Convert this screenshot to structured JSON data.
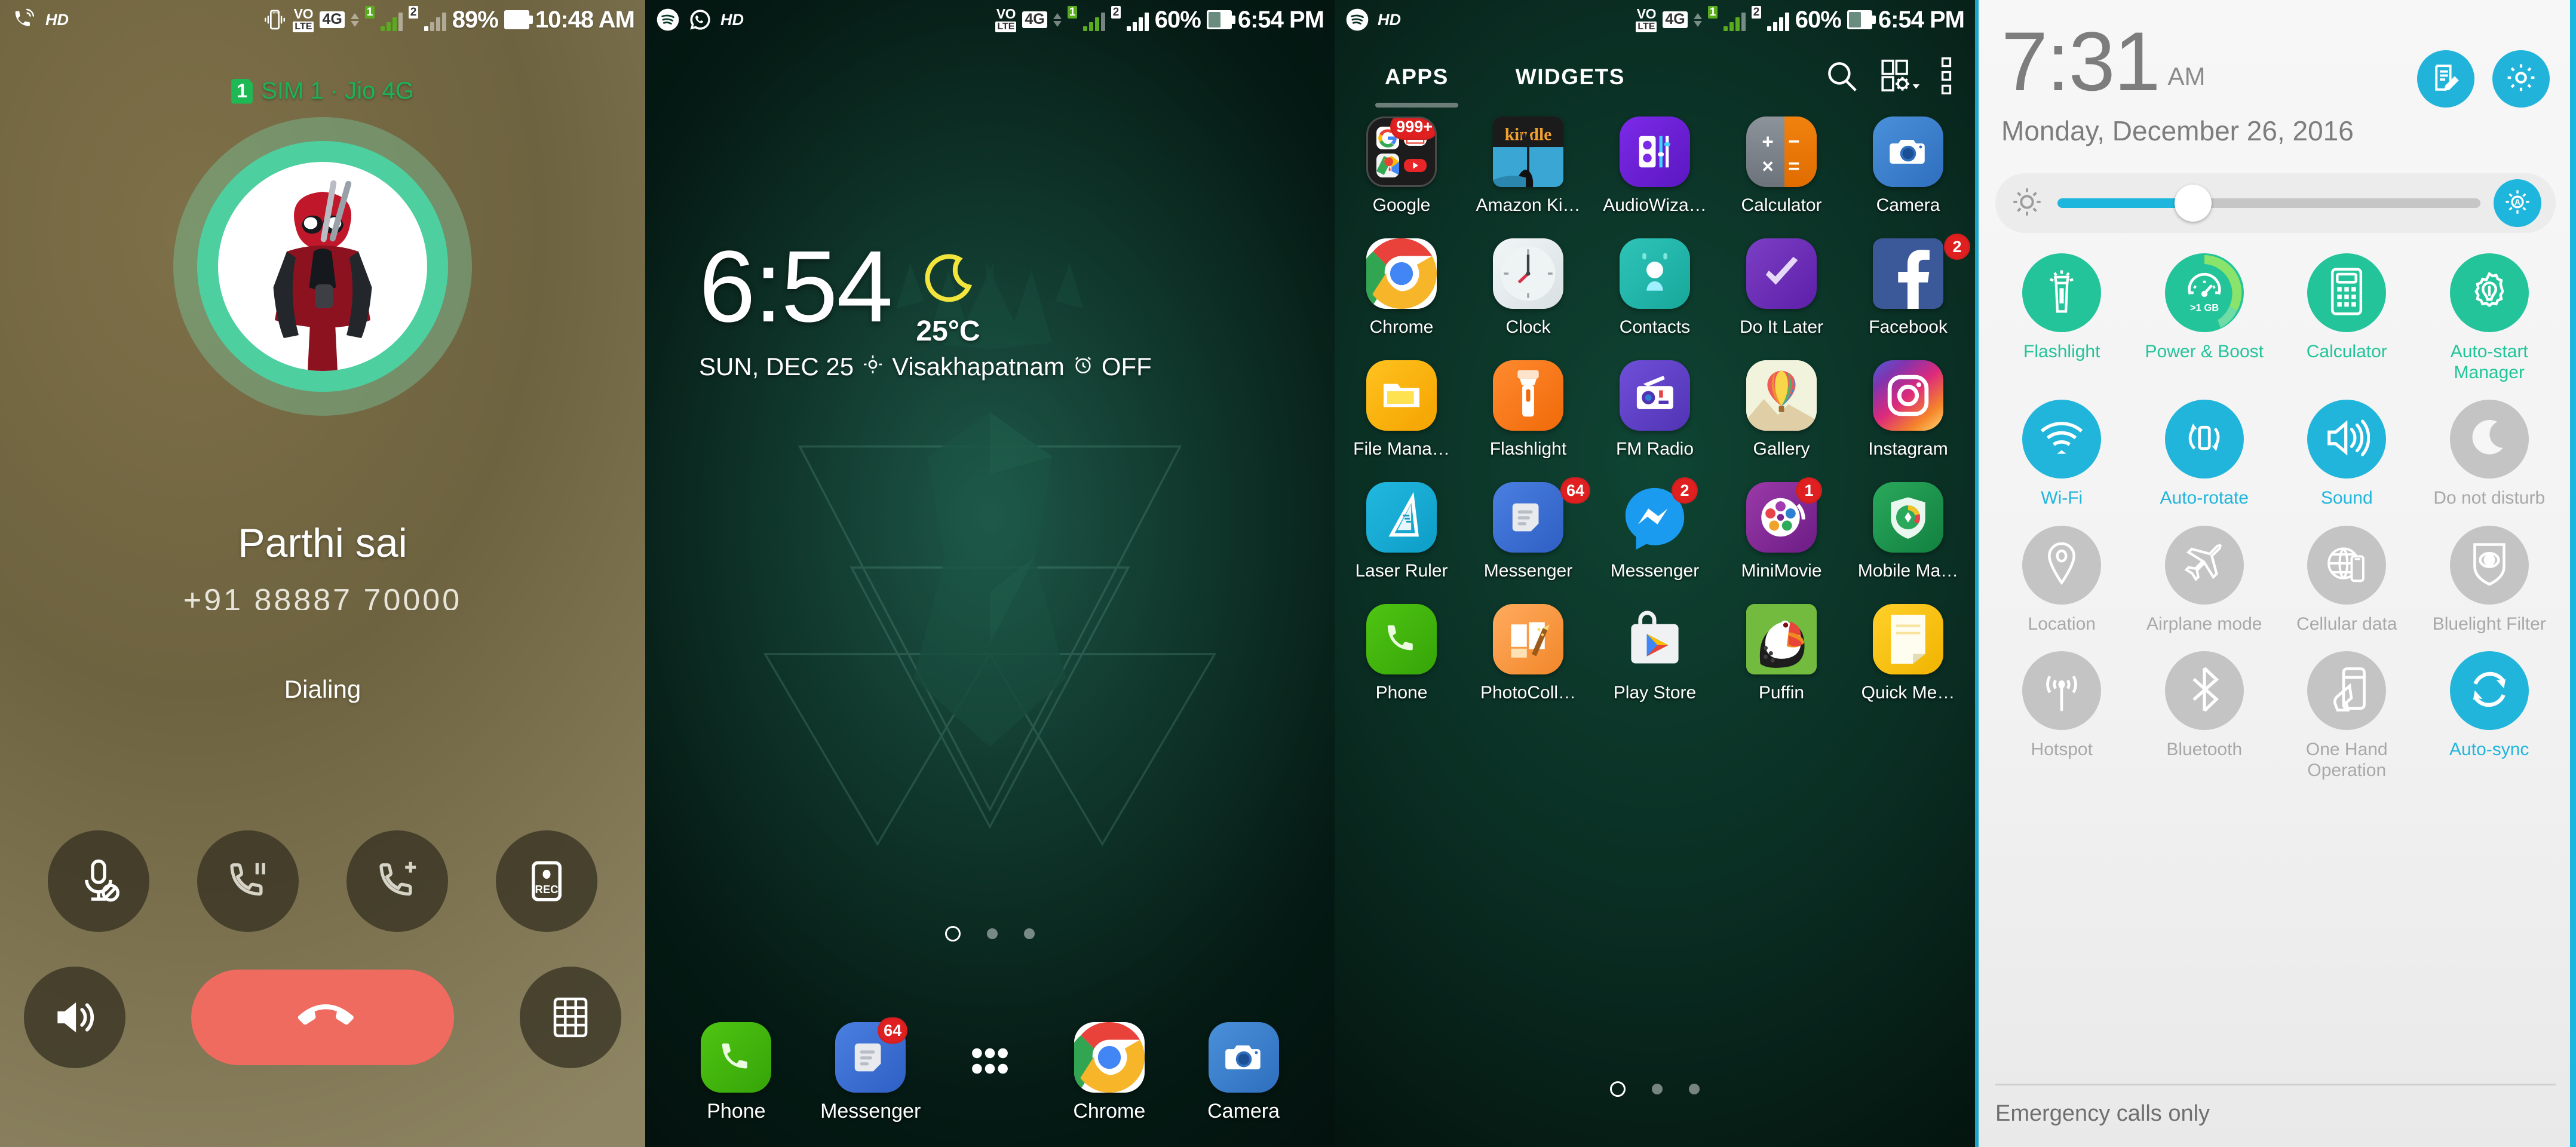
{
  "panel_call": {
    "statusbar": {
      "hd_label": "HD",
      "icons": [
        "call-hd-icon",
        "vibrate-icon",
        "volte-icon",
        "4g-icon",
        "data-arrows-icon",
        "sim1-signal-icon",
        "sim2-signal-icon"
      ],
      "volte_top": "VO",
      "volte_bottom": "LTE",
      "network_type": "4G",
      "sim1_label": "1",
      "sim2_label": "2",
      "battery_percent": "89%",
      "clock": "10:48 AM"
    },
    "sim_chip": "1",
    "sim_line": "SIM 1 · Jio 4G",
    "contact_name": "Parthi sai",
    "contact_number": "+91 88887 70000",
    "call_status": "Dialing",
    "controls": [
      {
        "name": "mute-button",
        "label": "Mute"
      },
      {
        "name": "hold-button",
        "label": "Hold"
      },
      {
        "name": "add-call-button",
        "label": "Add call"
      },
      {
        "name": "record-button",
        "label": "REC"
      }
    ],
    "controls_row2": [
      {
        "name": "speaker-button",
        "label": "Speaker"
      },
      {
        "name": "end-call-button",
        "label": "End call"
      },
      {
        "name": "keypad-button",
        "label": "Keypad"
      }
    ],
    "colors": {
      "sim_green": "#19b35a",
      "ring": "#4ecfa0",
      "end_call": "#ef6b60"
    }
  },
  "panel_home": {
    "statusbar": {
      "hd_label": "HD",
      "icons": [
        "spotify-icon",
        "whatsapp-icon"
      ],
      "volte_top": "VO",
      "volte_bottom": "LTE",
      "network_type": "4G",
      "sim1_label": "1",
      "sim2_label": "2",
      "battery_percent": "60%",
      "clock": "6:54 PM"
    },
    "clock_widget": {
      "time": "6:54",
      "date": "SUN, DEC 25",
      "location": "Visakhapatnam",
      "alarm": "OFF",
      "temperature": "25°C",
      "weather_icon": "crescent-moon-icon"
    },
    "page_indicator": {
      "count": 3,
      "current": 1
    },
    "dock": [
      {
        "label": "Phone",
        "icon": "phone-icon",
        "badge": null,
        "color": "#3fb60a"
      },
      {
        "label": "Messenger",
        "icon": "google-messenger-icon",
        "badge": "64",
        "color": "#3a6fd8"
      },
      {
        "label": "",
        "icon": "app-drawer-icon",
        "badge": null,
        "color": "transparent"
      },
      {
        "label": "Chrome",
        "icon": "chrome-icon",
        "badge": null,
        "color": "#ffffff"
      },
      {
        "label": "Camera",
        "icon": "camera-icon",
        "badge": null,
        "color": "#2f7fd1"
      }
    ]
  },
  "panel_drawer": {
    "statusbar": {
      "hd_label": "HD",
      "icons": [
        "spotify-icon"
      ],
      "volte_top": "VO",
      "volte_bottom": "LTE",
      "network_type": "4G",
      "sim1_label": "1",
      "sim2_label": "2",
      "battery_percent": "60%",
      "clock": "6:54 PM"
    },
    "tabs": [
      {
        "label": "APPS",
        "selected": true
      },
      {
        "label": "WIDGETS",
        "selected": false
      }
    ],
    "actions": [
      "search-icon",
      "grid-settings-icon",
      "overflow-menu-icon"
    ],
    "apps": [
      [
        {
          "label": "Google",
          "icon": "google-folder-icon",
          "badge": "999+"
        },
        {
          "label": "Amazon Ki…",
          "icon": "kindle-icon",
          "badge": null
        },
        {
          "label": "AudioWiza…",
          "icon": "audiowizard-icon",
          "badge": null
        },
        {
          "label": "Calculator",
          "icon": "calculator-icon",
          "badge": null
        },
        {
          "label": "Camera",
          "icon": "camera-icon",
          "badge": null
        }
      ],
      [
        {
          "label": "Chrome",
          "icon": "chrome-icon",
          "badge": null
        },
        {
          "label": "Clock",
          "icon": "clock-icon",
          "badge": null
        },
        {
          "label": "Contacts",
          "icon": "contacts-icon",
          "badge": null
        },
        {
          "label": "Do It Later",
          "icon": "do-it-later-icon",
          "badge": null
        },
        {
          "label": "Facebook",
          "icon": "facebook-icon",
          "badge": "2"
        }
      ],
      [
        {
          "label": "File Mana…",
          "icon": "file-manager-icon",
          "badge": null
        },
        {
          "label": "Flashlight",
          "icon": "flashlight-icon",
          "badge": null
        },
        {
          "label": "FM Radio",
          "icon": "fm-radio-icon",
          "badge": null
        },
        {
          "label": "Gallery",
          "icon": "gallery-icon",
          "badge": null
        },
        {
          "label": "Instagram",
          "icon": "instagram-icon",
          "badge": null
        }
      ],
      [
        {
          "label": "Laser Ruler",
          "icon": "laser-ruler-icon",
          "badge": null
        },
        {
          "label": "Messenger",
          "icon": "google-messenger-icon",
          "badge": "64"
        },
        {
          "label": "Messenger",
          "icon": "facebook-messenger-icon",
          "badge": "2"
        },
        {
          "label": "MiniMovie",
          "icon": "minimovie-icon",
          "badge": "1"
        },
        {
          "label": "Mobile Ma…",
          "icon": "mobile-manager-icon",
          "badge": null
        }
      ],
      [
        {
          "label": "Phone",
          "icon": "phone-icon",
          "badge": null
        },
        {
          "label": "PhotoColl…",
          "icon": "photocollage-icon",
          "badge": null
        },
        {
          "label": "Play Store",
          "icon": "play-store-icon",
          "badge": null
        },
        {
          "label": "Puffin",
          "icon": "puffin-icon",
          "badge": null
        },
        {
          "label": "Quick Me…",
          "icon": "quick-memo-icon",
          "badge": null
        }
      ]
    ],
    "page_indicator": {
      "count": 3,
      "current": 1
    }
  },
  "panel_quicksettings": {
    "time": "7:31",
    "ampm": "AM",
    "date": "Monday, December 26, 2016",
    "header_buttons": [
      {
        "name": "edit-notes-button",
        "icon": "notes-edit-icon"
      },
      {
        "name": "settings-button",
        "icon": "gear-icon"
      }
    ],
    "brightness": {
      "low_icon": "brightness-low-icon",
      "auto_icon": "brightness-auto-icon",
      "value_percent": 32
    },
    "toggles": [
      {
        "label": "Flashlight",
        "icon": "flashlight-icon",
        "state": "teal"
      },
      {
        "label": "Power & Boost",
        "icon": "power-boost-icon",
        "state": "teal",
        "sub": ">1 GB"
      },
      {
        "label": "Calculator",
        "icon": "calculator-icon",
        "state": "teal"
      },
      {
        "label": "Auto-start Manager",
        "icon": "autostart-manager-icon",
        "state": "teal"
      },
      {
        "label": "Wi-Fi",
        "icon": "wifi-icon",
        "state": "cyan"
      },
      {
        "label": "Auto-rotate",
        "icon": "auto-rotate-icon",
        "state": "cyan"
      },
      {
        "label": "Sound",
        "icon": "sound-icon",
        "state": "cyan"
      },
      {
        "label": "Do not disturb",
        "icon": "do-not-disturb-icon",
        "state": "grey"
      },
      {
        "label": "Location",
        "icon": "location-pin-icon",
        "state": "grey"
      },
      {
        "label": "Airplane mode",
        "icon": "airplane-icon",
        "state": "grey"
      },
      {
        "label": "Cellular data",
        "icon": "cellular-data-icon",
        "state": "grey"
      },
      {
        "label": "Bluelight Filter",
        "icon": "bluelight-filter-icon",
        "state": "grey"
      },
      {
        "label": "Hotspot",
        "icon": "hotspot-icon",
        "state": "grey"
      },
      {
        "label": "Bluetooth",
        "icon": "bluetooth-icon",
        "state": "grey"
      },
      {
        "label": "One Hand Operation",
        "icon": "one-hand-icon",
        "state": "grey"
      },
      {
        "label": "Auto-sync",
        "icon": "auto-sync-icon",
        "state": "cyan"
      }
    ],
    "footer_status": "Emergency calls only",
    "colors": {
      "teal": "#23c49a",
      "cyan": "#22b5db",
      "grey": "#c4c4c4",
      "accent": "#21b3d9"
    }
  }
}
